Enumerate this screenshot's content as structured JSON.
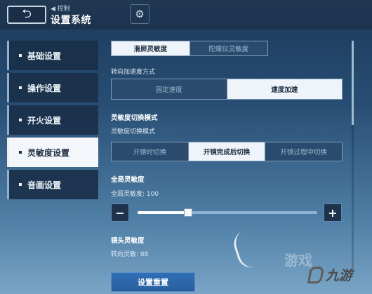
{
  "header": {
    "back_icon": "return-arrow-icon",
    "breadcrumb": "◀ 控制",
    "title": "设置系统",
    "settings_icon": "gear-icon"
  },
  "sidebar": {
    "items": [
      {
        "label": "基础设置",
        "active": false
      },
      {
        "label": "操作设置",
        "active": false
      },
      {
        "label": "开火设置",
        "active": false
      },
      {
        "label": "灵敏度设置",
        "active": true
      },
      {
        "label": "音画设置",
        "active": false
      }
    ]
  },
  "main": {
    "tabs": [
      {
        "label": "滑屏灵敏度",
        "selected": true
      },
      {
        "label": "陀螺仪灵敏度",
        "selected": false
      }
    ],
    "turn_accel": {
      "label": "转向加速度方式",
      "options": [
        {
          "label": "固定速度",
          "selected": false
        },
        {
          "label": "速度加速",
          "selected": true
        }
      ]
    },
    "switch_mode": {
      "section_title": "灵敏度切换模式",
      "label": "灵敏度切换模式",
      "options": [
        {
          "label": "开镜时切换",
          "selected": false
        },
        {
          "label": "开镜完成后切换",
          "selected": true
        },
        {
          "label": "开镜过程中切换",
          "selected": false
        }
      ]
    },
    "global": {
      "section_title": "全局灵敏度",
      "value_label": "全局灵敏度: 100",
      "value_fraction": 0.28,
      "minus": "−",
      "plus": "+"
    },
    "lens": {
      "section_title": "镜头灵敏度",
      "sub_label": "转向灵敏: 88"
    },
    "reset_label": "设置重置"
  },
  "watermark": {
    "text": "九游",
    "faint": "游戏"
  },
  "colors": {
    "accent_blue": "#2f6fb6",
    "selected_bg": "#eef4f9",
    "nav_bg": "#1a304a"
  }
}
